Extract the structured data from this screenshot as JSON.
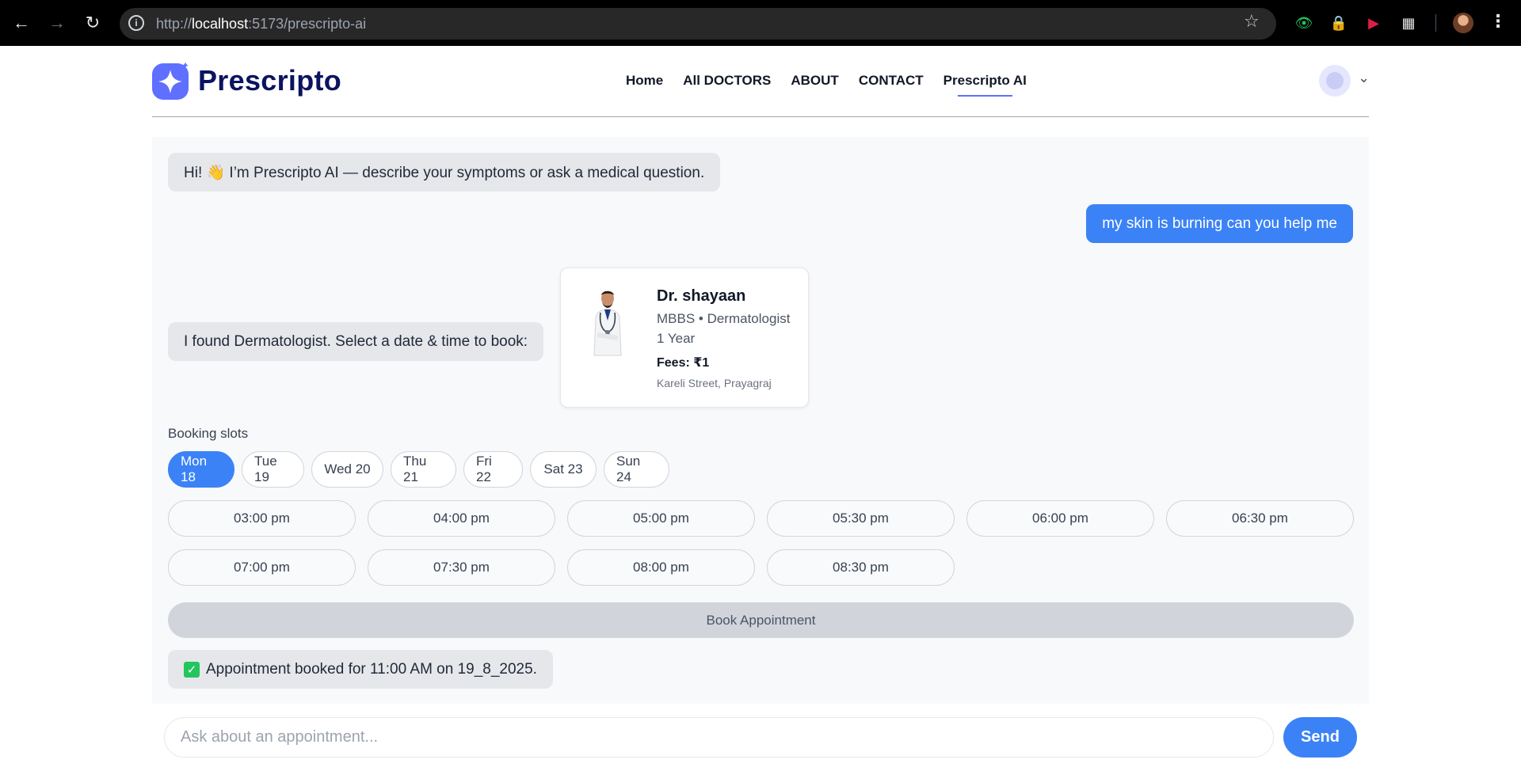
{
  "browser": {
    "url_scheme": "http://",
    "url_host": "localhost",
    "url_rest": ":5173/prescripto-ai"
  },
  "brand": {
    "name": "Prescripto",
    "accent": "#5f6fff",
    "primary_blue": "#3b82f6"
  },
  "nav": {
    "items": [
      {
        "label": "Home"
      },
      {
        "label": "All DOCTORS"
      },
      {
        "label": "ABOUT"
      },
      {
        "label": "CONTACT"
      },
      {
        "label": "Prescripto AI",
        "active": true
      }
    ]
  },
  "chat": {
    "greeting": "Hi! 👋 I’m Prescripto AI — describe your symptoms or ask a medical question.",
    "user_message": "my skin is burning can you help me",
    "found_message": "I found Dermatologist. Select a date & time to book:",
    "doctor": {
      "name": "Dr. shayaan",
      "specialty": "MBBS • Dermatologist",
      "experience": "1 Year",
      "fees": "Fees: ₹1",
      "address": "Kareli Street, Prayagraj"
    },
    "booking": {
      "label": "Booking slots",
      "days": [
        "Mon 18",
        "Tue 19",
        "Wed 20",
        "Thu 21",
        "Fri 22",
        "Sat 23",
        "Sun 24"
      ],
      "selected_day": "Mon 18",
      "times": [
        "03:00 pm",
        "04:00 pm",
        "05:00 pm",
        "05:30 pm",
        "06:00 pm",
        "06:30 pm",
        "07:00 pm",
        "07:30 pm",
        "08:00 pm",
        "08:30 pm"
      ],
      "book_button": "Book Appointment"
    },
    "confirmation": "Appointment booked for 11:00 AM on 19_8_2025."
  },
  "composer": {
    "placeholder": "Ask about an appointment...",
    "value": "",
    "send_label": "Send"
  }
}
